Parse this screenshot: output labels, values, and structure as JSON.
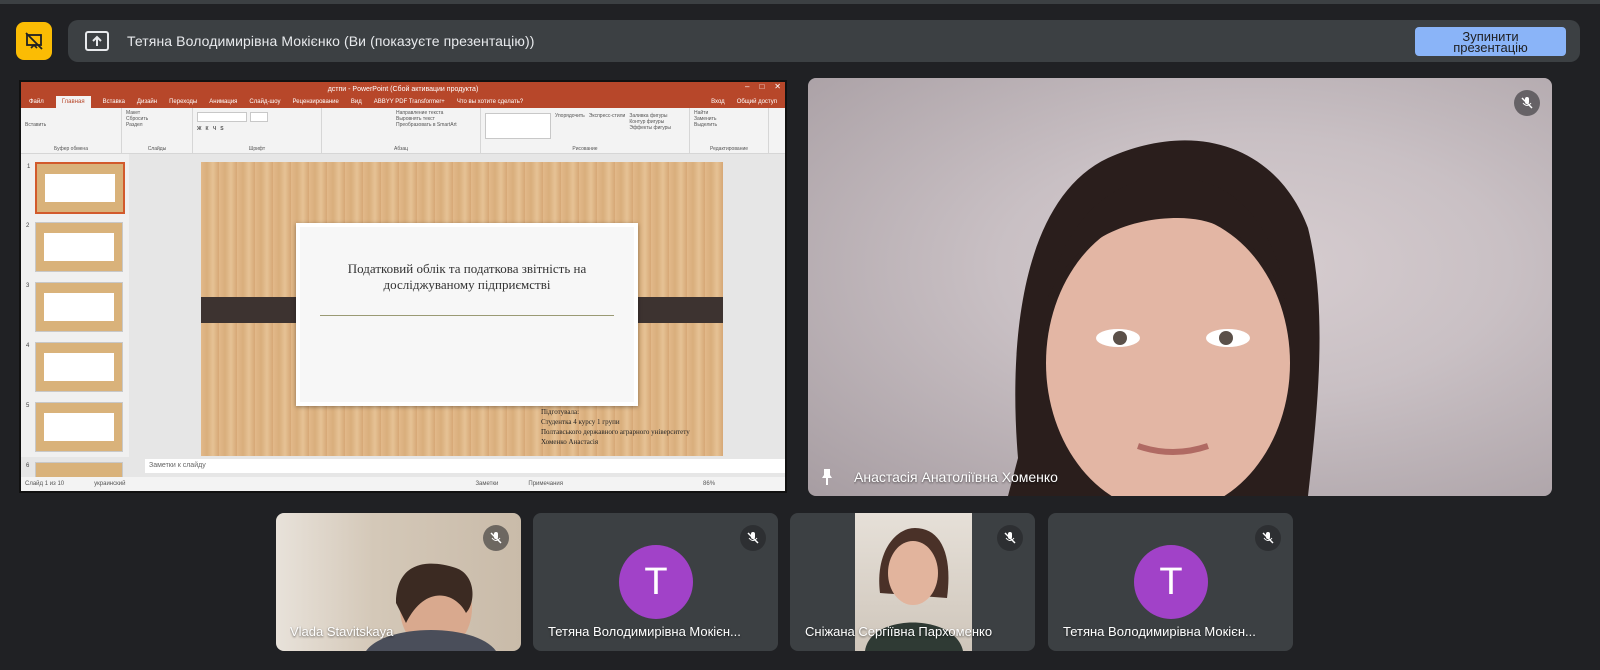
{
  "banner": {
    "title": "Тетяна Володимирівна Мокієнко (Ви (показуєте презентацію))",
    "stop_button": "Зупинити\nпрезентацію"
  },
  "presentation": {
    "window_title": "дстпи - PowerPoint (Сбой активации продукта)",
    "ribbon_tabs": [
      "Файл",
      "Главная",
      "Вставка",
      "Дизайн",
      "Переходы",
      "Анимация",
      "Слайд-шоу",
      "Рецензирование",
      "Вид",
      "ABBYY PDF Transformer+",
      "Что вы хотите сделать?"
    ],
    "active_tab": "Главная",
    "account": "Вход",
    "share": "Общий доступ",
    "ribbon_groups": [
      "Буфер обмена",
      "Слайды",
      "Шрифт",
      "Абзац",
      "Рисование",
      "Редактирование"
    ],
    "ribbon_items": {
      "paste": "Вставить",
      "new_slide": "Создать слайд",
      "layout": "Макет",
      "reset": "Сбросить",
      "section": "Раздел",
      "text_direction": "Направление текста",
      "align_text": "Выровнять текст",
      "smartart": "Преобразовать в SmartArt",
      "arrange": "Упорядочить",
      "quick_styles": "Экспресс-стили",
      "fill": "Заливка фигуры",
      "outline": "Контур фигуры",
      "effects": "Эффекты фигуры",
      "find": "Найти",
      "replace": "Заменить",
      "select": "Выделить"
    },
    "thumb_numbers": [
      "1",
      "2",
      "3",
      "4",
      "5",
      "6"
    ],
    "slide_title": "Податковий облік та податкова звітність на досліджуваному підприємстві",
    "slide_credit_lines": [
      "Підготувала:",
      "Студентка 4 курсу 1 групи",
      "Полтавського державного аграрного університету",
      "Хоменко Анастасія"
    ],
    "notes_placeholder": "Заметки к слайду",
    "status_slide": "Слайд 1 из 10",
    "status_lang": "украинский",
    "status_notes": "Заметки",
    "status_comments": "Примечания",
    "zoom": "86%"
  },
  "main_participant": {
    "name": "Анастасія Анатоліївна Хоменко"
  },
  "participants": [
    {
      "name": "Vlada Stavitskaya",
      "type": "video"
    },
    {
      "name": "Тетяна Володимирівна Мокієнко",
      "display": "Тетяна Володимирівна Мокієн...",
      "type": "avatar",
      "initial": "T"
    },
    {
      "name": "Сніжана Сергіївна Пархоменко",
      "type": "video"
    },
    {
      "name": "Тетяна Володимирівна Мокієнко",
      "display": "Тетяна Володимирівна Мокієн...",
      "type": "avatar",
      "initial": "T"
    }
  ],
  "colors": {
    "background": "#202124",
    "banner": "#3c4043",
    "stop_button": "#8ab4f8",
    "logo": "#fbbc04",
    "avatar": "#a142c8",
    "ppt_accent": "#b7472a"
  }
}
